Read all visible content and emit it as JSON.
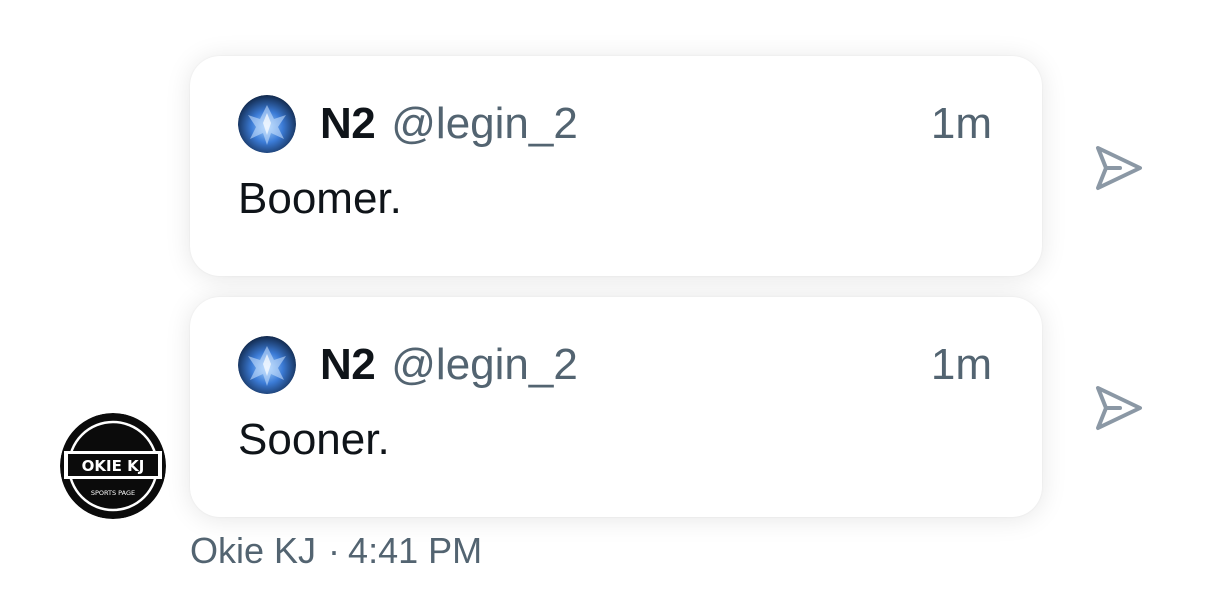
{
  "messages": [
    {
      "author_name": "N2",
      "author_handle": "@legin_2",
      "time": "1m",
      "text": "Boomer.",
      "avatar_icon": "blue-crystal-avatar",
      "share_icon": "send-icon"
    },
    {
      "author_name": "N2",
      "author_handle": "@legin_2",
      "time": "1m",
      "text": "Sooner.",
      "avatar_icon": "blue-crystal-avatar",
      "share_icon": "send-icon"
    }
  ],
  "sender": {
    "name": "Okie KJ",
    "separator": "·",
    "time": "4:41 PM",
    "avatar_text": "OKIE KJ",
    "avatar_subtext": "SPORTS PAGE"
  },
  "colors": {
    "text_primary": "#0f1419",
    "text_secondary": "#536471",
    "icon": "#8b98a5",
    "avatar_blue": "#3b7bd6"
  }
}
